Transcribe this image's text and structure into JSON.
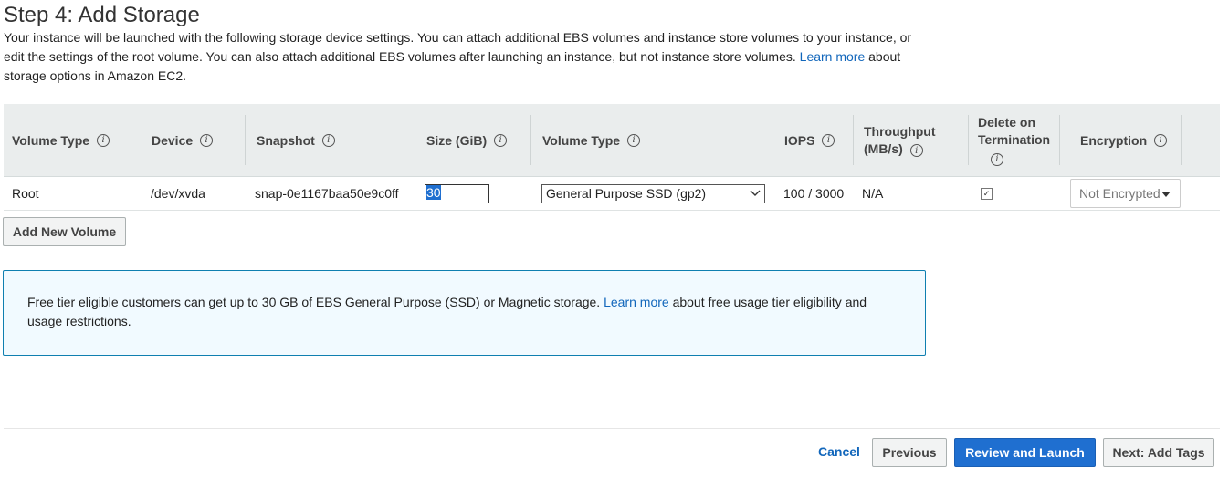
{
  "page": {
    "title": "Step 4: Add Storage",
    "description_pre": "Your instance will be launched with the following storage device settings. You can attach additional EBS volumes and instance store volumes to your instance, or edit the settings of the root volume. You can also attach additional EBS volumes after launching an instance, but not instance store volumes.",
    "description_link": "Learn more",
    "description_post": "about storage options in Amazon EC2."
  },
  "table": {
    "headers": {
      "volume_type": "Volume Type",
      "device": "Device",
      "snapshot": "Snapshot",
      "size": "Size (GiB)",
      "volume_type2": "Volume Type",
      "iops": "IOPS",
      "throughput_line1": "Throughput",
      "throughput_line2": "(MB/s)",
      "delete_line1": "Delete on",
      "delete_line2": "Termination",
      "encryption": "Encryption"
    },
    "rows": [
      {
        "volume_type": "Root",
        "device": "/dev/xvda",
        "snapshot": "snap-0e1167baa50e9c0ff",
        "size": "30",
        "volume_type_select": "General Purpose SSD (gp2)",
        "iops": "100 / 3000",
        "throughput": "N/A",
        "delete_on_termination": true,
        "encryption": "Not Encrypted"
      }
    ]
  },
  "buttons": {
    "add_volume": "Add New Volume",
    "cancel": "Cancel",
    "previous": "Previous",
    "review_launch": "Review and Launch",
    "next": "Next: Add Tags"
  },
  "notice": {
    "text_pre": "Free tier eligible customers can get up to 30 GB of EBS General Purpose (SSD) or Magnetic storage.",
    "link": "Learn more",
    "text_post": "about free usage tier eligibility and usage restrictions."
  },
  "colors": {
    "primary": "#1f6fd0",
    "link": "#1166bb",
    "notice_border": "#0f7fb0",
    "notice_bg": "#f1faff",
    "header_bg": "#eaeded"
  }
}
